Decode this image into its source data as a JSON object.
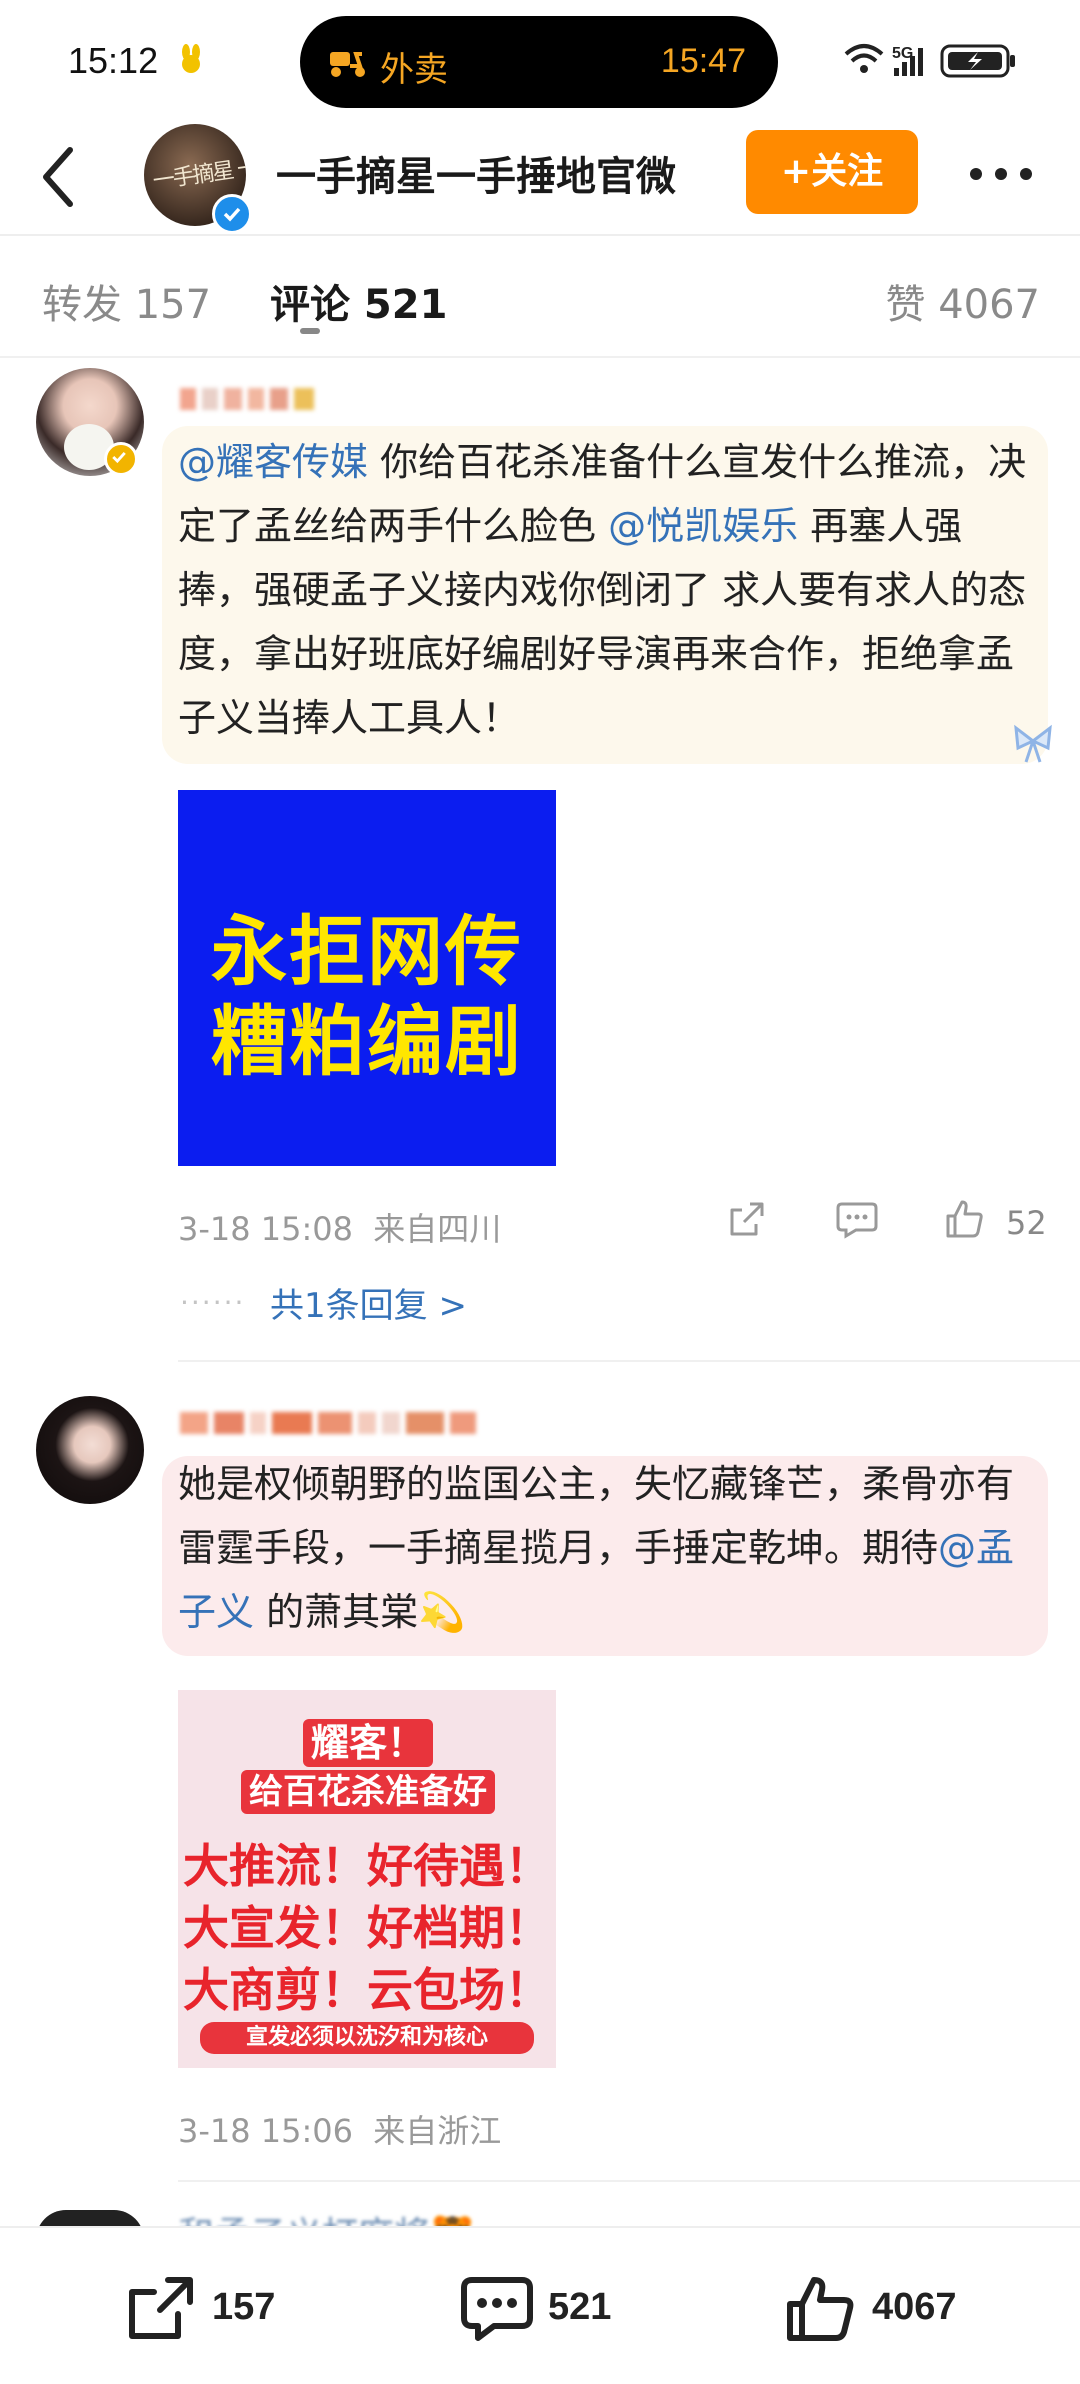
{
  "status_bar": {
    "time": "15:12",
    "pill_label": "外卖",
    "pill_time": "15:47",
    "network": "5G"
  },
  "header": {
    "account_name": "一手摘星一手捶地官微",
    "follow_label": "+关注",
    "avatar_text": "一手摘星 一手捶地"
  },
  "tabs": {
    "repost": "转发 157",
    "comments": "评论 521",
    "likes": "赞 4067"
  },
  "comments": [
    {
      "mention1": "@耀客传媒",
      "text1": " 你给百花杀准备什么宣发什么推流，决定了孟丝给两手什么脸色 ",
      "mention2": "@悦凯娱乐",
      "text2": " 再塞人强捧，强硬孟子义接内戏你倒闭了 求人要有求人的态度，拿出好班底好编剧好导演再来合作，拒绝拿孟子义当捧人工具人！",
      "image_lines": [
        "永拒网传",
        "糟粕编剧"
      ],
      "time": "3-18 15:08",
      "location": "来自四川",
      "like_count": "52",
      "reply_dots": "······",
      "reply_summary": "共1条回复 >"
    },
    {
      "text1": "她是权倾朝野的监国公主，失忆藏锋芒，柔骨亦有雷霆手段，一手摘星揽月，手捶定乾坤。期待",
      "mention1": "@孟子义",
      "text2": " 的萧其棠💫",
      "image_header1": "耀客！",
      "image_header2": "给百花杀准备好",
      "image_lines": [
        "大推流！好待遇！",
        "大宣发！好档期！",
        "大商剪！云包场！"
      ],
      "image_footer": "宣发必须以沈汐和为核心",
      "time": "3-18 15:06",
      "location": "来自浙江"
    }
  ],
  "peek_comment": {
    "name": "和孟子义打麻将🐯"
  },
  "bottom_bar": {
    "repost_count": "157",
    "comment_count": "521",
    "like_count": "4067"
  },
  "colors": {
    "follow_button": "#ff8a00",
    "mention": "#3572b8",
    "pill_text": "#f5a623",
    "image1_bg": "#0b1df0",
    "image1_text": "#ffe600",
    "image2_red": "#e8242c"
  }
}
